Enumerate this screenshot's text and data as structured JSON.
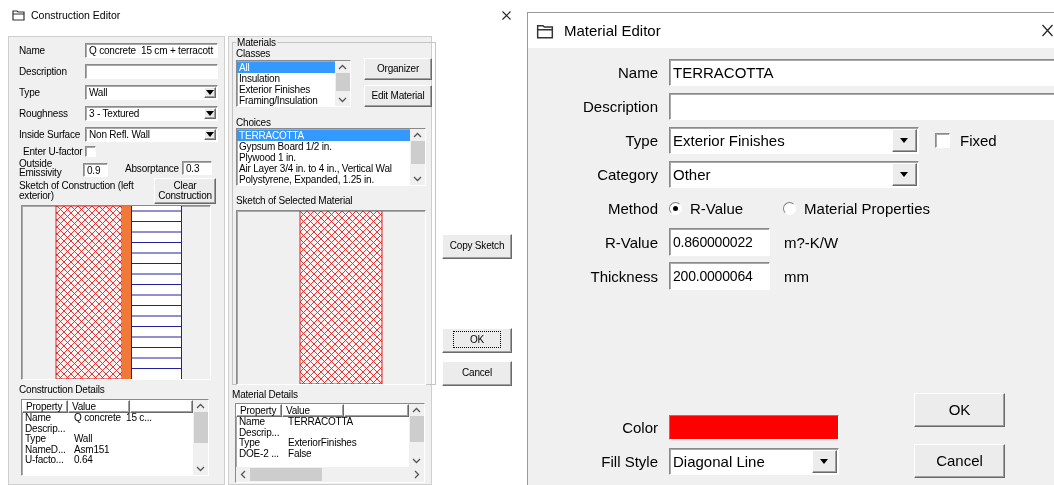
{
  "construction_editor": {
    "title": "Construction Editor",
    "fields": [
      {
        "label": "Name",
        "kind": "text",
        "value": "Q concrete  15 cm + terracott"
      },
      {
        "label": "Description",
        "kind": "text"
      },
      {
        "label": "Type",
        "kind": "combo",
        "value": "Wall"
      },
      {
        "label": "Roughness",
        "kind": "combo",
        "value": "3 - Textured"
      },
      {
        "label": "Inside Surface",
        "kind": "combo",
        "value": "Non Refl. Wall"
      }
    ],
    "u_factor": {
      "label": "Enter U-factor",
      "checked": false
    },
    "emissivity": {
      "label": "Outside Emissivity",
      "kind": "text",
      "value": "0.9"
    },
    "absorptance": {
      "label": "Absorptance",
      "kind": "text",
      "value": "0.3"
    },
    "sketch_label": "Sketch of Construction (left exterior)",
    "clear_button": "Clear Construction",
    "sketch": {
      "layers": [
        {
          "kind": "crosshatch",
          "color": "#e02020"
        },
        {
          "kind": "solid",
          "color": "#f07838"
        },
        {
          "kind": "lines",
          "color": "#2020a0"
        }
      ]
    },
    "details": {
      "label": "Construction Details",
      "columns": [
        "Property",
        "Value"
      ],
      "rows": [
        [
          "Name",
          "Q concrete  15 c..."
        ],
        [
          "Descrip..."
        ],
        [
          "Type",
          "Wall"
        ],
        [
          "NameD...",
          "Asm151"
        ],
        [
          "U-facto...",
          "0.64"
        ]
      ]
    },
    "materials": {
      "label": "Materials",
      "classes_label": "Classes",
      "classes": [
        {
          "label": "All",
          "selected": true
        },
        {
          "label": "Insulation",
          "selected": false
        },
        {
          "label": "Exterior Finishes",
          "selected": false
        },
        {
          "label": "Framing/Insulation",
          "selected": false
        }
      ],
      "buttons": [
        "Organizer",
        "Edit Material"
      ],
      "choices_label": "Choices",
      "choices": [
        {
          "label": "TERRACOTTA",
          "selected": true
        },
        {
          "label": "Gypsum Board 1/2 in.",
          "selected": false
        },
        {
          "label": "Plywood 1 in.",
          "selected": false
        },
        {
          "label": "Air Layer 3/4 in. to 4 in., Vertical Wal",
          "selected": false
        },
        {
          "label": "Polystyrene, Expanded, 1.25 in.",
          "selected": false
        }
      ],
      "sketch_label": "Sketch of Selected Material",
      "sketch": {
        "layers": [
          {
            "kind": "crosshatch",
            "color": "#e02020"
          }
        ]
      },
      "details": {
        "label": "Material Details",
        "columns": [
          "Property",
          "Value"
        ],
        "rows": [
          [
            "Name",
            "TERRACOTTA"
          ],
          [
            "Descrip..."
          ],
          [
            "Type",
            "ExteriorFinishes"
          ],
          [
            "DOE-2 ...",
            "False"
          ]
        ]
      }
    },
    "buttons": [
      {
        "label": "Copy Sketch",
        "focused": false
      },
      {
        "label": "OK",
        "focused": true
      },
      {
        "label": "Cancel",
        "focused": false
      }
    ]
  },
  "material_editor": {
    "title": "Material Editor",
    "name": {
      "label": "Name",
      "kind": "text",
      "value": "TERRACOTTA"
    },
    "description": {
      "label": "Description",
      "kind": "text"
    },
    "type": {
      "label": "Type",
      "kind": "combo",
      "value": "Exterior Finishes"
    },
    "fixed": {
      "label": "Fixed",
      "checked": false
    },
    "category": {
      "label": "Category",
      "kind": "combo",
      "value": "Other"
    },
    "method": {
      "label": "Method",
      "options": [
        {
          "label": "R-Value",
          "selected": true
        },
        {
          "label": "Material Properties",
          "selected": false
        }
      ]
    },
    "r_value": {
      "label": "R-Value",
      "kind": "text",
      "value": "0.860000022",
      "unit": "m?-K/W"
    },
    "thickness": {
      "label": "Thickness",
      "kind": "text",
      "value": "200.0000064",
      "unit": "mm"
    },
    "color": {
      "label": "Color",
      "color": "#ff0000"
    },
    "fill_style": {
      "label": "Fill Style",
      "kind": "combo",
      "value": "Diagonal Line"
    },
    "buttons": [
      "OK",
      "Cancel"
    ]
  }
}
